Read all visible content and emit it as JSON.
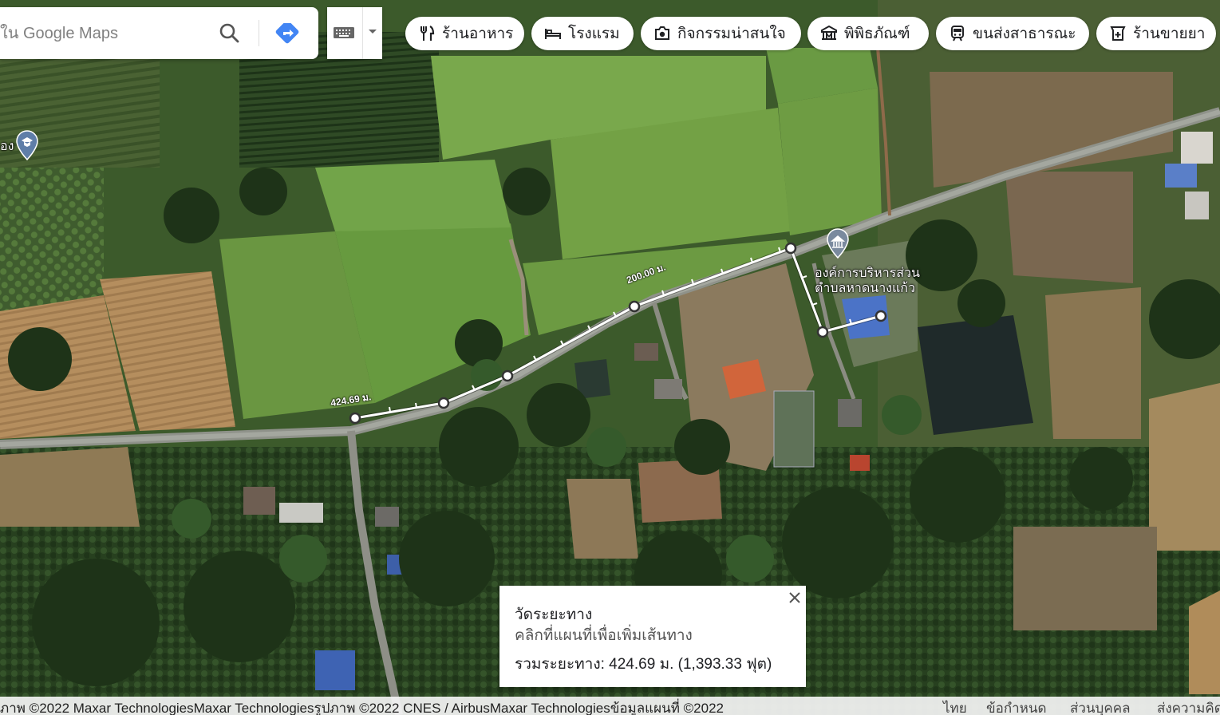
{
  "search": {
    "placeholder": "ใน Google Maps"
  },
  "chips": [
    {
      "label": "ร้านอาหาร",
      "icon": "fork-knife-icon"
    },
    {
      "label": "โรงแรม",
      "icon": "bed-icon"
    },
    {
      "label": "กิจกรรมน่าสนใจ",
      "icon": "camera-icon"
    },
    {
      "label": "พิพิธภัณฑ์",
      "icon": "museum-icon"
    },
    {
      "label": "ขนส่งสาธารณะ",
      "icon": "train-icon"
    },
    {
      "label": "ร้านขายยา",
      "icon": "pharmacy-icon"
    }
  ],
  "map": {
    "poi_left_label": "อง",
    "poi_left_icon": "school-icon",
    "poi_main_label_line1": "องค์การบริหารส่วน",
    "poi_main_label_line2": "ตำบลหาดนางแก้ว",
    "poi_main_icon": "government-office-icon",
    "measure_label_segment": "200.00 ม.",
    "measure_label_total": "424.69 ม."
  },
  "measure_card": {
    "title": "วัดระยะทาง",
    "hint": "คลิกที่แผนที่เพื่อเพิ่มเส้นทาง",
    "total": "รวมระยะทาง: 424.69 ม. (1,393.33 ฟุต)"
  },
  "footer": {
    "attribution": "ภาพ ©2022 Maxar TechnologiesMaxar Technologiesรูปภาพ ©2022 CNES / AirbusMaxar Technologiesข้อมูลแผนที่ ©2022",
    "language": "ไทย",
    "terms": "ข้อกำหนด",
    "privacy": "ส่วนบุคคล",
    "feedback": "ส่งความคิดเห็น"
  },
  "colors": {
    "directions_blue": "#4285f4",
    "measure_line": "#ffffff",
    "road": "#8a8f86",
    "field_green": "#6f9a3f"
  }
}
